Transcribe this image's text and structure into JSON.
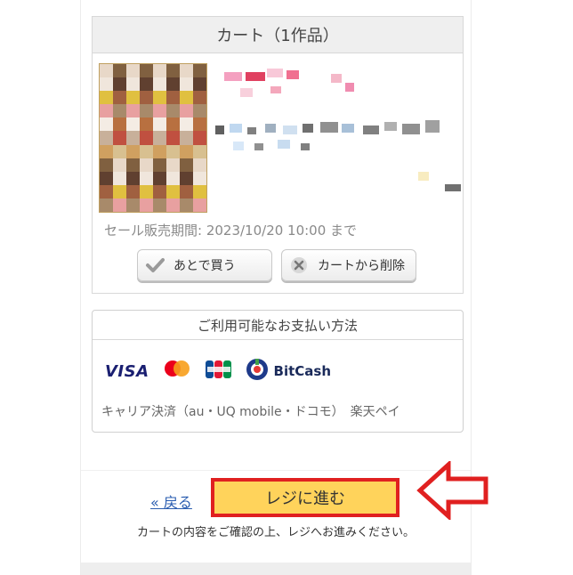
{
  "cart": {
    "title": "カート（1作品）",
    "sale_period": "セール販売期間: 2023/10/20 10:00 まで",
    "later_label": "あとで買う",
    "remove_label": "カートから削除"
  },
  "payment": {
    "title": "ご利用可能なお支払い方法",
    "logos": {
      "visa": "VISA",
      "bitcash": "BitCash"
    },
    "carriers": "キャリア決済（au・UQ mobile・ドコモ）　楽天ペイ"
  },
  "footer": {
    "back_label": "« 戻る",
    "checkout_label": "レジに進む",
    "note": "カートの内容をご確認の上、レジへお進みください。"
  },
  "colors": {
    "checkout_bg": "#ffd35b",
    "checkout_border": "#e02020",
    "link": "#2a5db0",
    "arrow": "#e02020"
  },
  "icons": [
    "check-icon",
    "x-icon",
    "mastercard-icon",
    "jcb-icon",
    "bitcash-icon",
    "arrow-left-icon"
  ]
}
